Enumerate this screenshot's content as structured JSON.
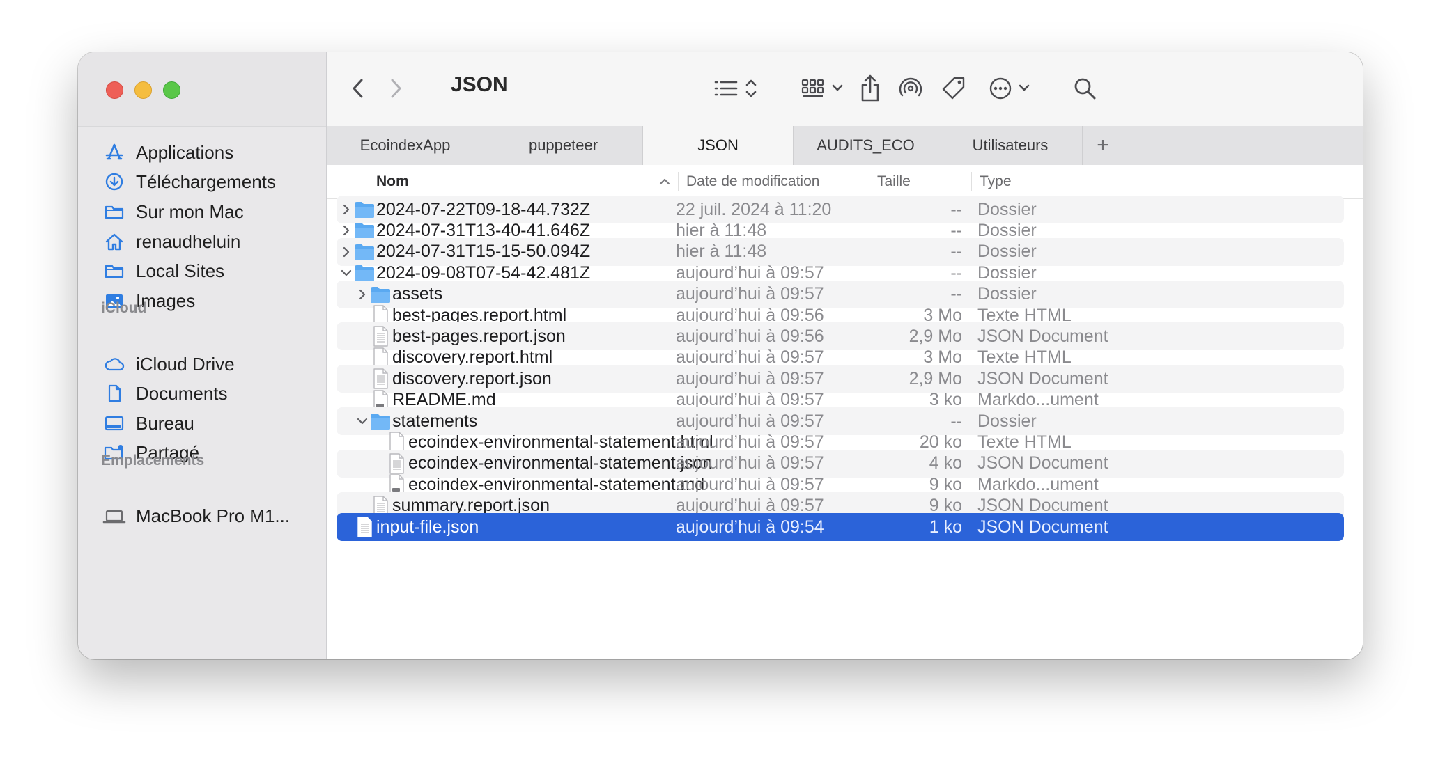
{
  "window": {
    "title": "JSON"
  },
  "sidebar": {
    "items": [
      {
        "label": "Applications",
        "icon": "applications-icon"
      },
      {
        "label": "Téléchargements",
        "icon": "downloads-icon"
      },
      {
        "label": "Sur mon Mac",
        "icon": "folder-icon"
      },
      {
        "label": "renaudheluin",
        "icon": "home-icon"
      },
      {
        "label": "Local Sites",
        "icon": "folder-icon"
      },
      {
        "label": "Images",
        "icon": "photos-icon"
      }
    ],
    "icloud_header": "iCloud",
    "icloud_items": [
      {
        "label": "iCloud Drive",
        "icon": "cloud-icon"
      },
      {
        "label": "Documents",
        "icon": "document-icon"
      },
      {
        "label": "Bureau",
        "icon": "desktop-icon"
      },
      {
        "label": "Partagé",
        "icon": "shared-folder-icon"
      }
    ],
    "locations_header": "Emplacements",
    "location_items": [
      {
        "label": "MacBook Pro M1...",
        "icon": "laptop-icon"
      }
    ]
  },
  "tabs": [
    {
      "label": "EcoindexApp"
    },
    {
      "label": "puppeteer"
    },
    {
      "label": "JSON",
      "active": true
    },
    {
      "label": "AUDITS_ECO"
    },
    {
      "label": "Utilisateurs"
    }
  ],
  "tab_add_label": "+",
  "columns": {
    "name": "Nom",
    "date": "Date de modification",
    "size": "Taille",
    "kind": "Type"
  },
  "files": [
    {
      "name": "2024-07-22T09-18-44.732Z",
      "date": "22 juil. 2024 à 11:20",
      "size": "--",
      "kind": "Dossier",
      "level": 0,
      "icon": "folder",
      "disclosure": "collapsed"
    },
    {
      "name": "2024-07-31T13-40-41.646Z",
      "date": "hier à 11:48",
      "size": "--",
      "kind": "Dossier",
      "level": 0,
      "icon": "folder",
      "disclosure": "collapsed"
    },
    {
      "name": "2024-07-31T15-15-50.094Z",
      "date": "hier à 11:48",
      "size": "--",
      "kind": "Dossier",
      "level": 0,
      "icon": "folder",
      "disclosure": "collapsed"
    },
    {
      "name": "2024-09-08T07-54-42.481Z",
      "date": "aujourd’hui à 09:57",
      "size": "--",
      "kind": "Dossier",
      "level": 0,
      "icon": "folder",
      "disclosure": "expanded"
    },
    {
      "name": "assets",
      "date": "aujourd’hui à 09:57",
      "size": "--",
      "kind": "Dossier",
      "level": 1,
      "icon": "folder",
      "disclosure": "collapsed"
    },
    {
      "name": "best-pages.report.html",
      "date": "aujourd’hui à 09:56",
      "size": "3 Mo",
      "kind": "Texte HTML",
      "level": 1,
      "icon": "file-blank"
    },
    {
      "name": "best-pages.report.json",
      "date": "aujourd’hui à 09:56",
      "size": "2,9 Mo",
      "kind": "JSON Document",
      "level": 1,
      "icon": "file-text"
    },
    {
      "name": "discovery.report.html",
      "date": "aujourd’hui à 09:57",
      "size": "3 Mo",
      "kind": "Texte HTML",
      "level": 1,
      "icon": "file-blank"
    },
    {
      "name": "discovery.report.json",
      "date": "aujourd’hui à 09:57",
      "size": "2,9 Mo",
      "kind": "JSON Document",
      "level": 1,
      "icon": "file-text"
    },
    {
      "name": "README.md",
      "date": "aujourd’hui à 09:57",
      "size": "3 ko",
      "kind": "Markdo...ument",
      "level": 1,
      "icon": "file-md"
    },
    {
      "name": "statements",
      "date": "aujourd’hui à 09:57",
      "size": "--",
      "kind": "Dossier",
      "level": 1,
      "icon": "folder",
      "disclosure": "expanded"
    },
    {
      "name": "ecoindex-environmental-statement.html",
      "date": "aujourd’hui à 09:57",
      "size": "20 ko",
      "kind": "Texte HTML",
      "level": 2,
      "icon": "file-blank"
    },
    {
      "name": "ecoindex-environmental-statement.json",
      "date": "aujourd’hui à 09:57",
      "size": "4 ko",
      "kind": "JSON Document",
      "level": 2,
      "icon": "file-text"
    },
    {
      "name": "ecoindex-environmental-statement.md",
      "date": "aujourd’hui à 09:57",
      "size": "9 ko",
      "kind": "Markdo...ument",
      "level": 2,
      "icon": "file-md"
    },
    {
      "name": "summary.report.json",
      "date": "aujourd’hui à 09:57",
      "size": "9 ko",
      "kind": "JSON Document",
      "level": 1,
      "icon": "file-text"
    },
    {
      "name": "input-file.json",
      "date": "aujourd’hui à 09:54",
      "size": "1 ko",
      "kind": "JSON Document",
      "level": 0,
      "icon": "file-text",
      "selected": true
    }
  ],
  "colors": {
    "accent": "#2b63d9",
    "folder": "#5aa9f1",
    "sidebar_icon": "#2f7de1"
  }
}
